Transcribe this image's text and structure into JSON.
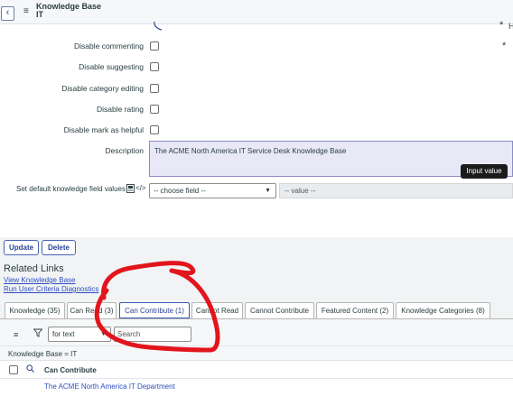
{
  "header": {
    "back_icon": "chevron-left-icon",
    "menu_icon": "hamburger-icon",
    "title_line1": "Knowledge Base",
    "title_line2": "IT"
  },
  "form": {
    "required_marker": "*",
    "partial_field_label": "H",
    "checkboxes": [
      {
        "label": "Disable commenting",
        "checked": false
      },
      {
        "label": "Disable suggesting",
        "checked": false
      },
      {
        "label": "Disable category editing",
        "checked": false
      },
      {
        "label": "Disable rating",
        "checked": false
      },
      {
        "label": "Disable mark as helpful",
        "checked": false
      }
    ],
    "description_label": "Description",
    "description_value": "The ACME North America IT Service Desk Knowledge Base",
    "tooltip": "Input value",
    "default_values_label": "Set default knowledge field values",
    "choose_field": "-- choose field --",
    "value_placeholder": "-- value --"
  },
  "actions": {
    "update": "Update",
    "delete": "Delete"
  },
  "related_links": {
    "title": "Related Links",
    "links": [
      "View Knowledge Base",
      "Run User Criteria Diagnostics"
    ]
  },
  "tabs": [
    {
      "label": "Knowledge (35)",
      "active": false
    },
    {
      "label": "Can Read (3)",
      "active": false
    },
    {
      "label": "Can Contribute (1)",
      "active": true
    },
    {
      "label": "Cannot Read",
      "active": false
    },
    {
      "label": "Cannot Contribute",
      "active": false
    },
    {
      "label": "Featured Content (2)",
      "active": false
    },
    {
      "label": "Knowledge Categories (8)",
      "active": false
    }
  ],
  "list": {
    "filter_select": "for text",
    "search_placeholder": "Search",
    "breadcrumb": "Knowledge Base = IT",
    "column_header": "Can Contribute",
    "rows": [
      "The ACME North America IT Department"
    ]
  },
  "colors": {
    "accent": "#2c4494",
    "link": "#2f4ec0",
    "annotation": "#e2141c"
  }
}
